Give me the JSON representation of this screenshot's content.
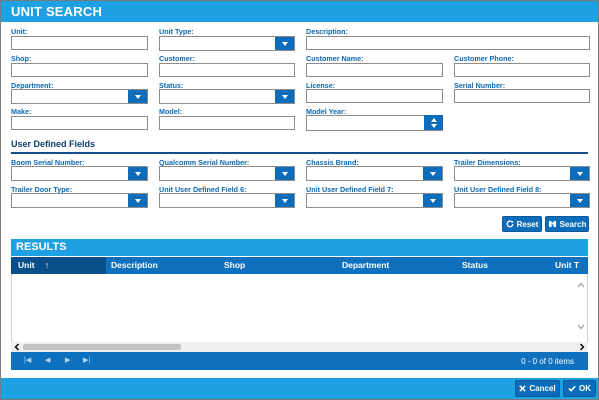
{
  "title": "UNIT SEARCH",
  "fields": {
    "unit": "Unit:",
    "unit_type": "Unit Type:",
    "description": "Description:",
    "shop": "Shop:",
    "customer": "Customer:",
    "customer_name": "Customer Name:",
    "customer_phone": "Customer Phone:",
    "department": "Department:",
    "status": "Status:",
    "license": "License:",
    "serial_number": "Serial Number:",
    "make": "Make:",
    "model": "Model:",
    "model_year": "Model Year:"
  },
  "udf": {
    "section_title": "User Defined Fields",
    "boom_serial": "Boom Serial Number:",
    "qualcomm_serial": "Qualcomm Serial Number:",
    "chassis_brand": "Chassis Brand:",
    "trailer_dimensions": "Trailer Dimensions:",
    "trailer_door_type": "Trailer Door Type:",
    "udf6": "Unit User Defined Field 6:",
    "udf7": "Unit User Defined Field 7:",
    "udf8": "Unit User Defined Field 8:"
  },
  "buttons": {
    "reset": "Reset",
    "search": "Search",
    "cancel": "Cancel",
    "ok": "OK"
  },
  "results": {
    "title": "RESULTS",
    "columns": [
      "Unit",
      "Description",
      "Shop",
      "Department",
      "Status",
      "Unit T"
    ],
    "sort_indicator": "↑",
    "pager_text": "0 - 0 of 0 items"
  },
  "icons": {
    "reset": "refresh-icon",
    "search": "binoculars-icon",
    "cancel": "x-icon",
    "ok": "check-icon"
  },
  "colors": {
    "header_blue": "#1ea1e3",
    "dark_blue": "#0f70be",
    "label_blue": "#0d69b1"
  }
}
